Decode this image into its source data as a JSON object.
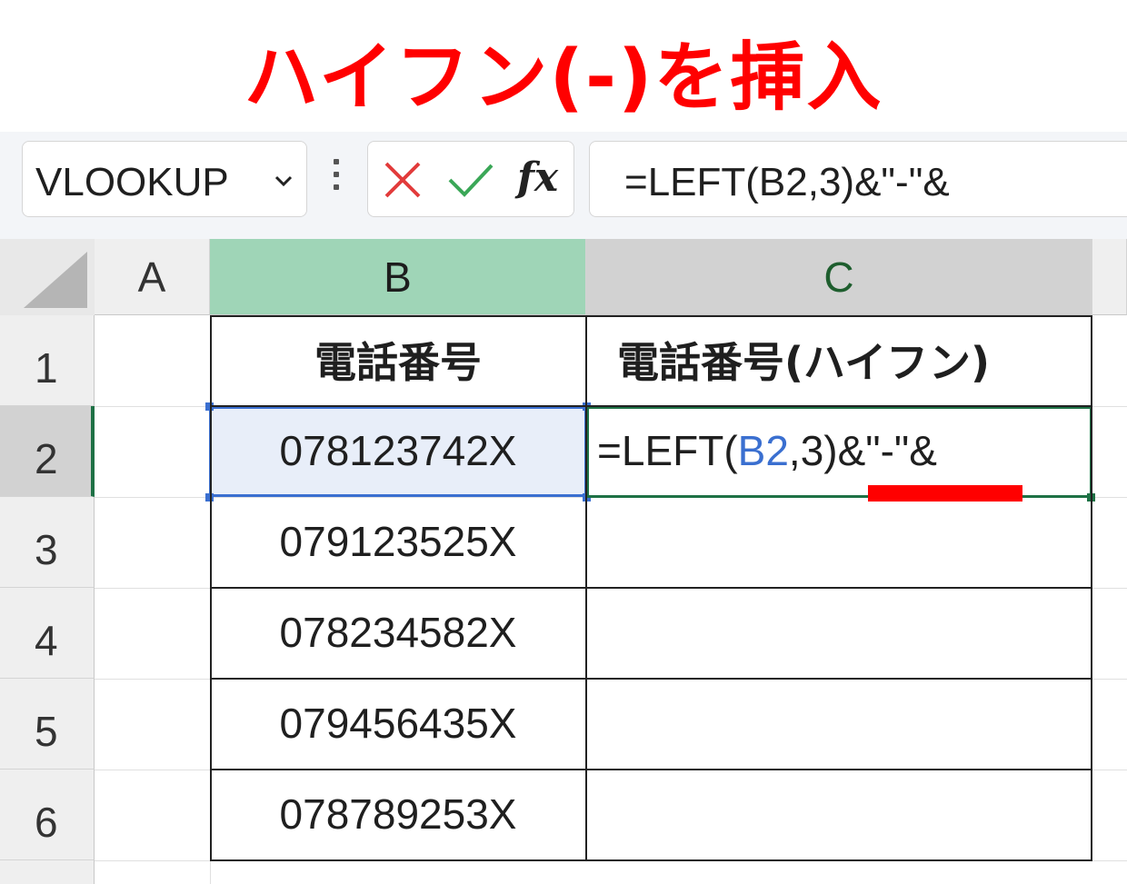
{
  "title": "ハイフン(-)を挿入",
  "formula_bar": {
    "name_box": "VLOOKUP",
    "formula": "=LEFT(B2,3)&\"-\"&",
    "fx_label": "fx"
  },
  "columns": [
    "A",
    "B",
    "C"
  ],
  "rows": [
    "1",
    "2",
    "3",
    "4",
    "5",
    "6"
  ],
  "cells": {
    "B1": "電話番号",
    "C1": "電話番号(ハイフン)",
    "B2": "078123742X",
    "B3": "079123525X",
    "B4": "078234582X",
    "B5": "079456435X",
    "B6": "078789253X"
  },
  "edit_cell": {
    "prefix": "=LEFT(",
    "ref": "B2",
    "suffix": ",3)&\"-\"&"
  },
  "colors": {
    "title": "#ff0000",
    "ref_highlight": "#3a6fd0",
    "active_border": "#1e7145",
    "underline": "#ff0000"
  }
}
